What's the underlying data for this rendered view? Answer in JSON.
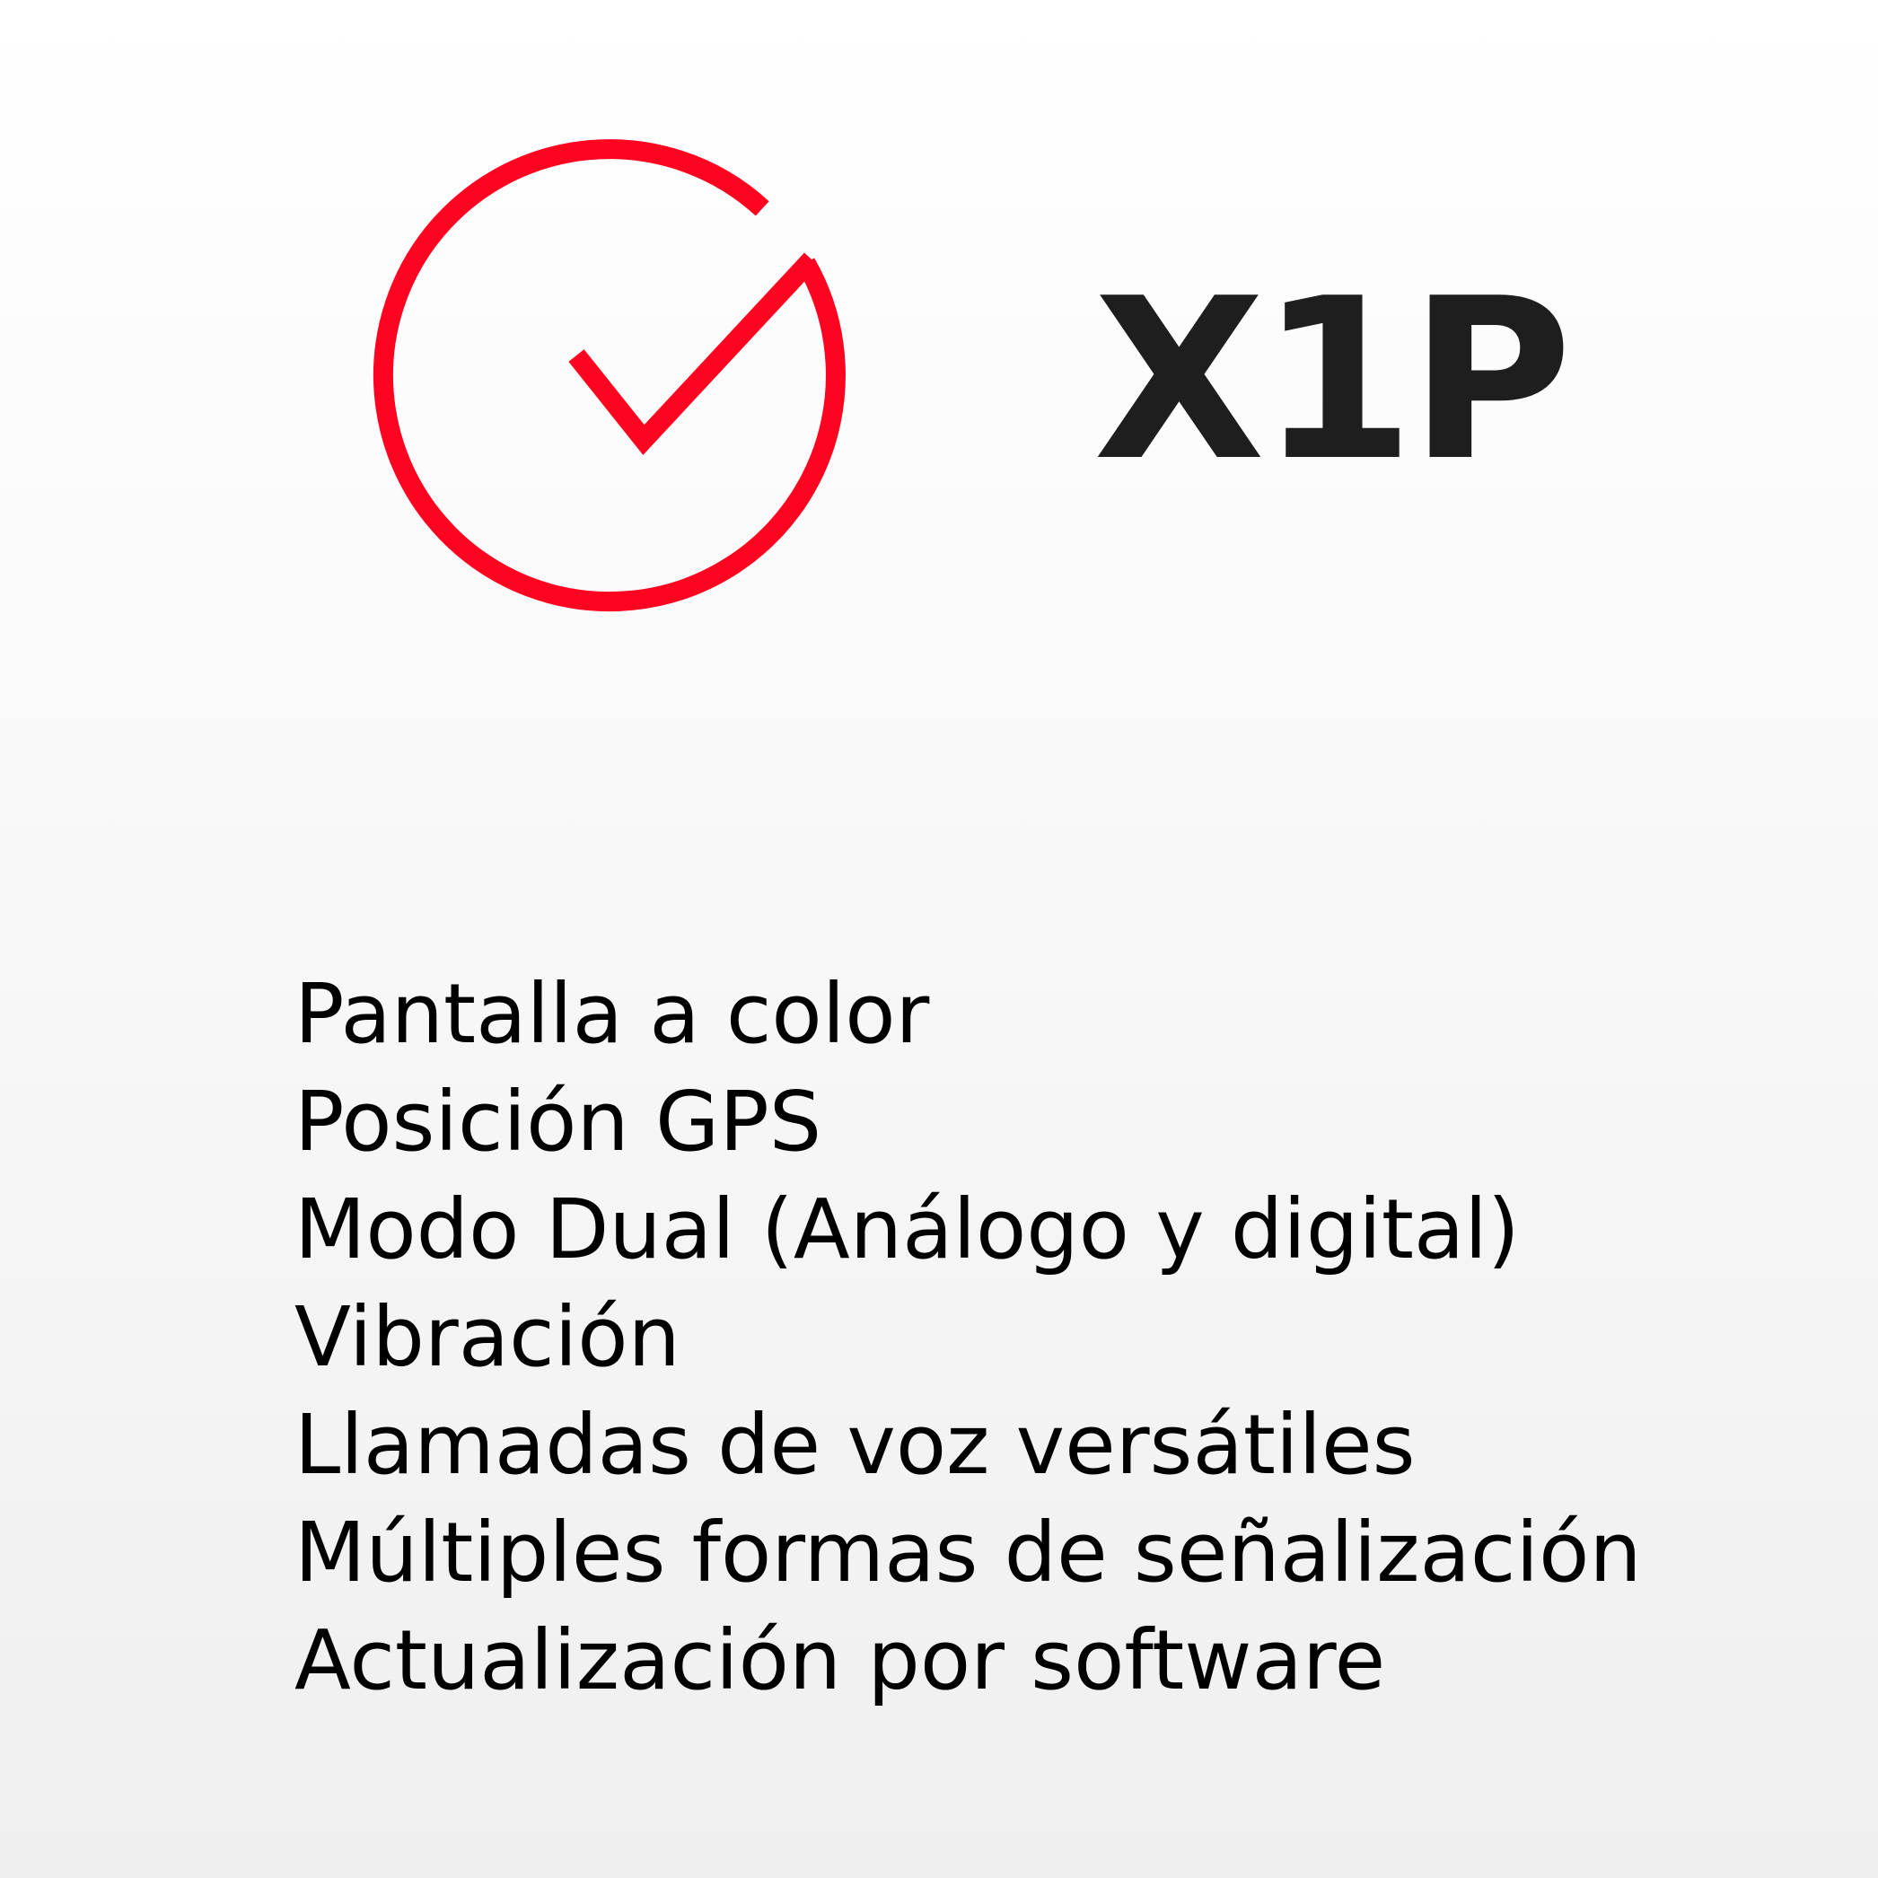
{
  "model": {
    "name": "X1P"
  },
  "icon": {
    "name": "check-circle-icon",
    "color": "#ff0420"
  },
  "features": [
    "Pantalla a color",
    "Posición GPS",
    "Modo Dual (Análogo y digital)",
    "Vibración",
    "Llamadas de voz versátiles",
    "Múltiples formas de señalización",
    "Actualización por software"
  ],
  "colors": {
    "accent": "#ff0420",
    "title": "#1e1e1e",
    "text": "#000000"
  }
}
